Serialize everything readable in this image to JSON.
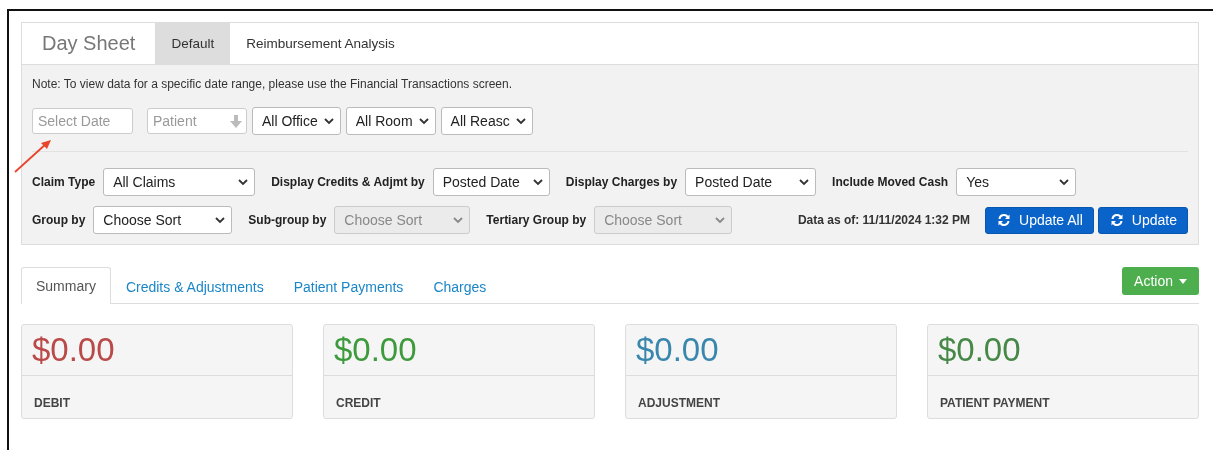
{
  "header": {
    "title": "Day Sheet",
    "tabs": [
      {
        "label": "Default",
        "selected": true
      },
      {
        "label": "Reimbursement Analysis",
        "selected": false
      }
    ]
  },
  "note": "Note: To view data for a specific date range, please use the Financial Transactions screen.",
  "quick_filters": [
    {
      "kind": "input",
      "placeholder": "Select Date"
    },
    {
      "kind": "search",
      "placeholder": "Patient"
    },
    {
      "kind": "select",
      "value": "All Office"
    },
    {
      "kind": "select",
      "value": "All Room"
    },
    {
      "kind": "select",
      "value": "All Reasc"
    }
  ],
  "filter_rows": [
    [
      {
        "label": "Claim Type",
        "value": "All Claims",
        "disabled": false
      },
      {
        "label": "Display Credits & Adjmt by",
        "value": "Posted Date",
        "disabled": false
      },
      {
        "label": "Display Charges by",
        "value": "Posted Date",
        "disabled": false
      },
      {
        "label": "Include Moved Cash",
        "value": "Yes",
        "disabled": false
      }
    ],
    [
      {
        "label": "Group by",
        "value": "Choose Sort",
        "disabled": false
      },
      {
        "label": "Sub-group by",
        "value": "Choose Sort",
        "disabled": true
      },
      {
        "label": "Tertiary Group by",
        "value": "Choose Sort",
        "disabled": true
      }
    ]
  ],
  "data_as_of": "Data as of: 11/11/2024 1:32 PM",
  "update_buttons": [
    "Update All",
    "Update"
  ],
  "result_tabs": [
    {
      "label": "Summary",
      "selected": true
    },
    {
      "label": "Credits & Adjustments",
      "selected": false
    },
    {
      "label": "Patient Payments",
      "selected": false
    },
    {
      "label": "Charges",
      "selected": false
    }
  ],
  "action_button": "Action",
  "cards": [
    {
      "amount": "$0.00",
      "label": "DEBIT",
      "color": "#b94a48"
    },
    {
      "amount": "$0.00",
      "label": "CREDIT",
      "color": "#3d9a3d"
    },
    {
      "amount": "$0.00",
      "label": "ADJUSTMENT",
      "color": "#3a87ad"
    },
    {
      "amount": "$0.00",
      "label": "PATIENT PAYMENT",
      "color": "#468847"
    }
  ]
}
